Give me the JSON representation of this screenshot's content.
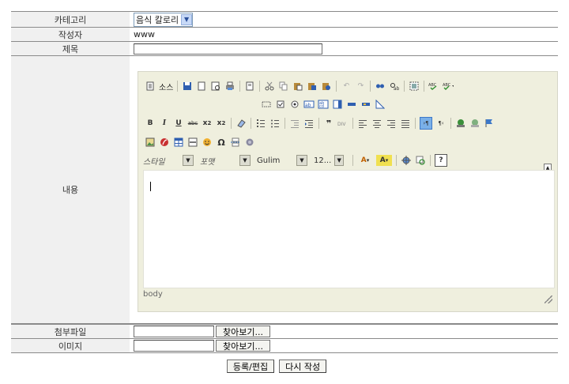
{
  "form": {
    "category": {
      "label": "카테고리",
      "selected": "음식 칼로리"
    },
    "author": {
      "label": "작성자",
      "value": "www"
    },
    "subject": {
      "label": "제목",
      "value": ""
    },
    "content": {
      "label": "내용"
    },
    "attachment": {
      "label": "첨부파일",
      "browse": "찾아보기..."
    },
    "image": {
      "label": "이미지",
      "browse": "찾아보기..."
    }
  },
  "editor": {
    "source_label": "소스",
    "style_combo": "스타일",
    "format_combo": "포맷",
    "font_combo": "Gulim",
    "size_combo": "12...",
    "status_path": "body",
    "icons_row1": [
      "source-icon",
      "save-icon",
      "new-page-icon",
      "preview-icon",
      "print-icon",
      "templates-icon",
      "cut-icon",
      "copy-icon",
      "paste-icon",
      "paste-text-icon",
      "paste-word-icon",
      "undo-icon",
      "redo-icon",
      "find-icon",
      "replace-icon",
      "select-all-icon",
      "spellcheck-icon",
      "spellcheck-dropdown-icon"
    ],
    "icons_row2": [
      "form-icon",
      "checkbox-icon",
      "radio-icon",
      "textfield-icon",
      "textarea-icon",
      "select-icon",
      "button-icon",
      "imagebutton-icon",
      "hiddenfield-icon"
    ],
    "icons_row3": [
      "bold-icon",
      "italic-icon",
      "underline-icon",
      "strike-icon",
      "subscript-icon",
      "superscript-icon",
      "remove-format-icon",
      "ordered-list-icon",
      "unordered-list-icon",
      "outdent-icon",
      "indent-icon",
      "blockquote-icon",
      "div-icon",
      "align-left-icon",
      "align-center-icon",
      "align-right-icon",
      "justify-icon",
      "ltr-icon",
      "rtl-icon",
      "link-icon",
      "unlink-icon",
      "anchor-icon"
    ],
    "icons_row4": [
      "image-icon",
      "flash-icon",
      "table-icon",
      "hr-icon",
      "smiley-icon",
      "special-char-icon",
      "pagebreak-icon",
      "iframe-icon"
    ],
    "icons_row5": [
      "text-color-icon",
      "bg-color-icon",
      "maximize-icon",
      "show-blocks-icon",
      "about-icon"
    ]
  },
  "buttons": {
    "submit": "등록/편집",
    "rewrite": "다시 작성"
  },
  "colors": {
    "label_bg": "#f0f0f0",
    "editor_bg": "#efefde",
    "border": "#8a8a8a"
  }
}
